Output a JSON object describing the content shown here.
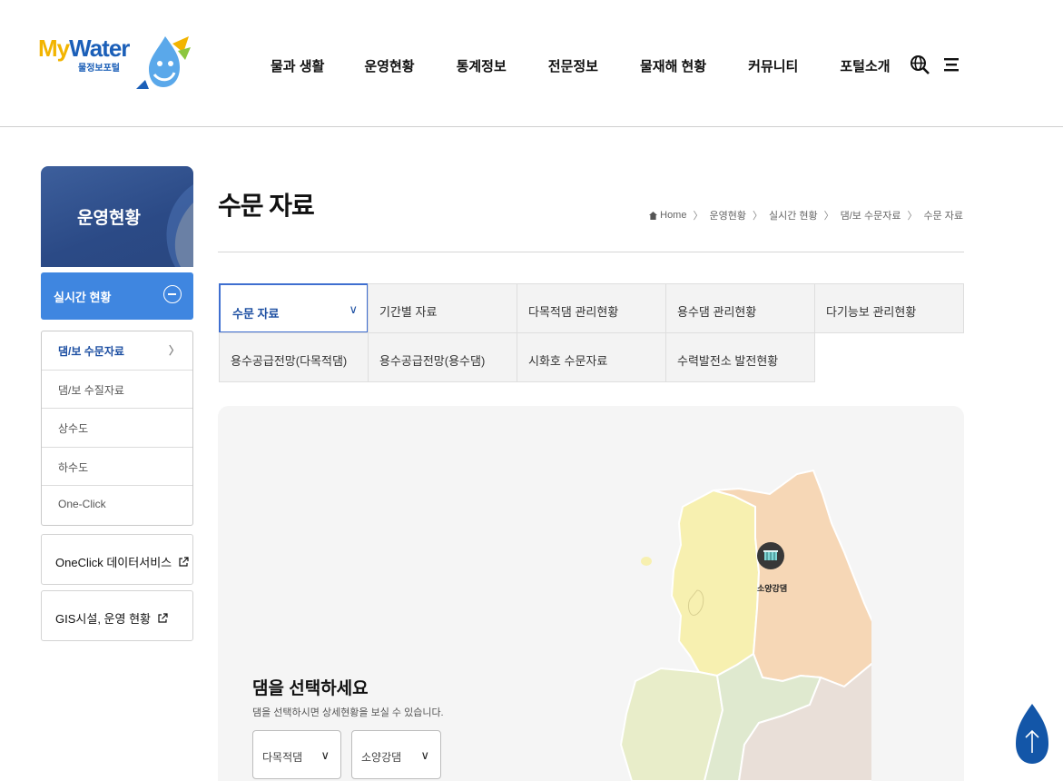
{
  "header": {
    "logo_my": "My",
    "logo_water": "Water",
    "logo_sub": "물정보포털",
    "nav": [
      "물과 생활",
      "운영현황",
      "통계정보",
      "전문정보",
      "물재해 현황",
      "커뮤니티",
      "포털소개"
    ],
    "icons": [
      "globe-search-icon",
      "menu-icon"
    ]
  },
  "sidebar": {
    "title": "운영현황",
    "section": "실시간 현황",
    "items": [
      {
        "label": "댐/보 수문자료",
        "active": true
      },
      {
        "label": "댐/보 수질자료",
        "active": false
      },
      {
        "label": "상수도",
        "active": false
      },
      {
        "label": "하수도",
        "active": false
      },
      {
        "label": "One-Click",
        "active": false
      }
    ],
    "links": [
      "OneClick 데이터서비스",
      "GIS시설, 운영 현황"
    ]
  },
  "main": {
    "title": "수문 자료",
    "breadcrumb": [
      "Home",
      "운영현황",
      "실시간 현황",
      "댐/보 수문자료",
      "수문 자료"
    ],
    "tabs": [
      {
        "label": "수문 자료",
        "selected": true
      },
      {
        "label": "기간별 자료"
      },
      {
        "label": "다목적댐 관리현황"
      },
      {
        "label": "용수댐 관리현황"
      },
      {
        "label": "다기능보 관리현황"
      },
      {
        "label": "용수공급전망(다목적댐)"
      },
      {
        "label": "용수공급전망(용수댐)"
      },
      {
        "label": "시화호 수문자료"
      },
      {
        "label": "수력발전소 발전현황"
      }
    ],
    "map": {
      "select_title": "댐을 선택하세요",
      "select_desc": "댐을 선택하시면 상세현황을 보실 수 있습니다.",
      "dam_type": "다목적댐",
      "dam_name": "소양강댐",
      "marker_label": "소양강댐",
      "region_colors": [
        "#f7f0b0",
        "#f6d7b6",
        "#e8edc9",
        "#dfe9cf",
        "#e9dfd8"
      ]
    }
  },
  "colors": {
    "primary": "#2b4a86",
    "accent": "#3f86e0",
    "top_button": "#1356a8"
  }
}
